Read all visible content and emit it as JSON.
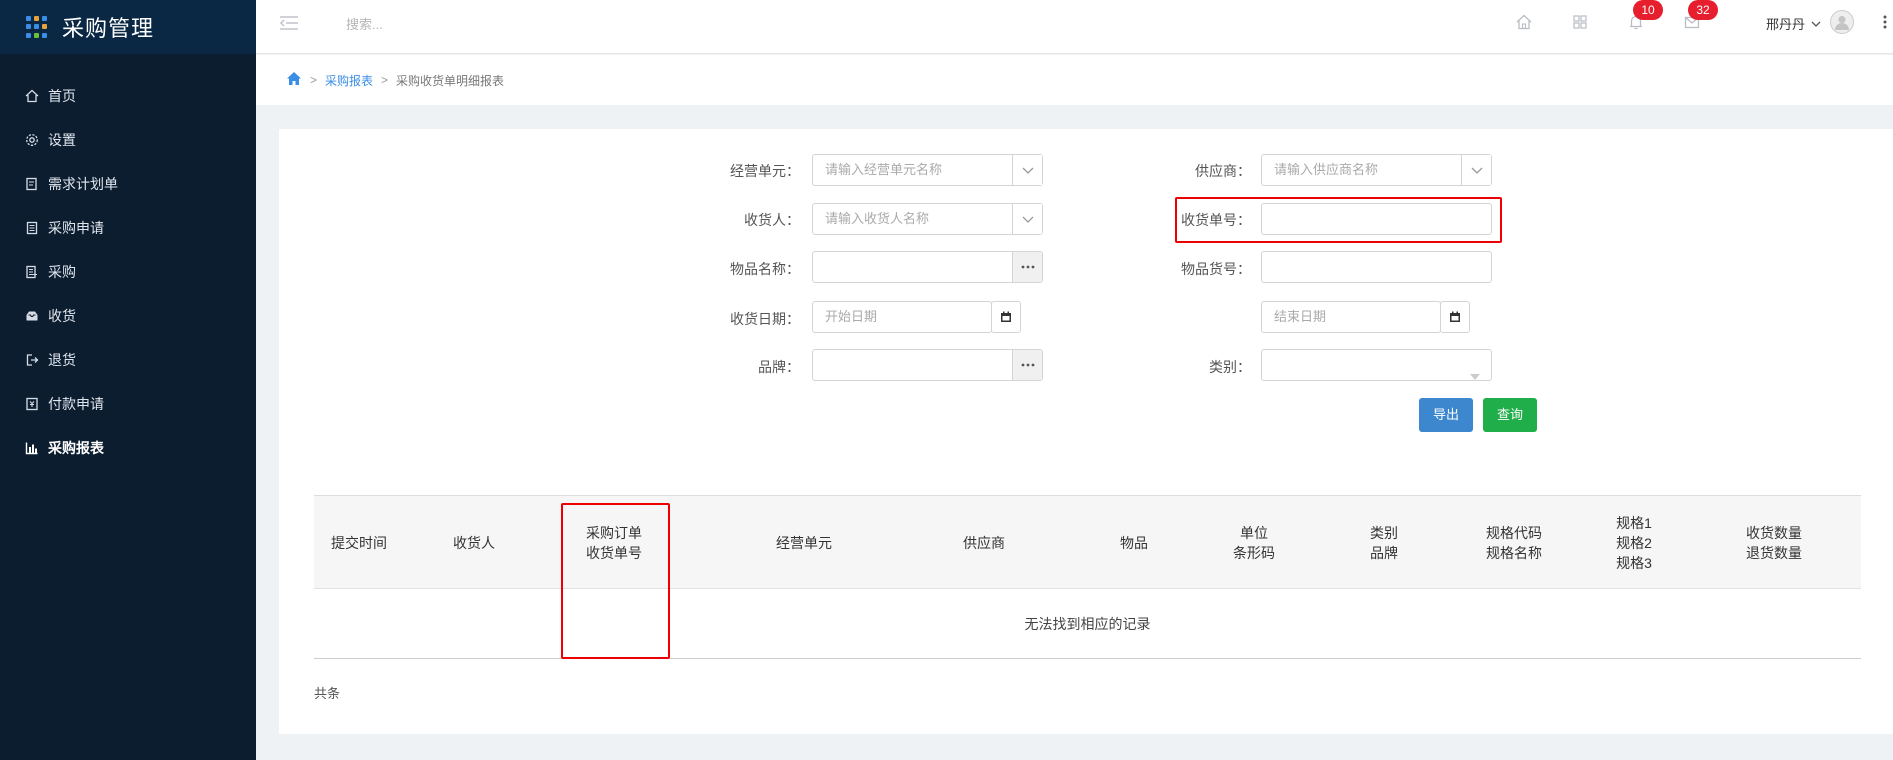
{
  "app": {
    "title": "采购管理"
  },
  "sidebar": {
    "items": [
      {
        "label": "首页",
        "icon": "home-icon"
      },
      {
        "label": "设置",
        "icon": "gear-icon"
      },
      {
        "label": "需求计划单",
        "icon": "document-icon"
      },
      {
        "label": "采购申请",
        "icon": "receipt-icon"
      },
      {
        "label": "采购",
        "icon": "list-icon"
      },
      {
        "label": "收货",
        "icon": "inbox-icon"
      },
      {
        "label": "退货",
        "icon": "logout-icon"
      },
      {
        "label": "付款申请",
        "icon": "payment-icon"
      },
      {
        "label": "采购报表",
        "icon": "bar-chart-icon",
        "active": true
      }
    ]
  },
  "topbar": {
    "search_placeholder": "搜索...",
    "notifications_count": "10",
    "messages_count": "32",
    "user_name": "邢丹丹"
  },
  "breadcrumb": {
    "items": [
      "采购报表",
      "采购收货单明细报表"
    ]
  },
  "form": {
    "unit_label": "经营单元：",
    "unit_placeholder": "请输入经营单元名称",
    "supplier_label": "供应商：",
    "supplier_placeholder": "请输入供应商名称",
    "receiver_label": "收货人：",
    "receiver_placeholder": "请输入收货人名称",
    "receipt_no_label": "收货单号：",
    "receipt_no_value": "",
    "item_name_label": "物品名称：",
    "item_name_value": "",
    "item_code_label": "物品货号：",
    "item_code_value": "",
    "date_label": "收货日期：",
    "start_date_placeholder": "开始日期",
    "end_date_placeholder": "结束日期",
    "brand_label": "品牌：",
    "brand_value": "",
    "category_label": "类别：",
    "category_value": "",
    "export_label": "导出",
    "query_label": "查询"
  },
  "table": {
    "columns": [
      [
        "提交时间"
      ],
      [
        "收货人"
      ],
      [
        "采购订单",
        "收货单号"
      ],
      [
        "经营单元"
      ],
      [
        "供应商"
      ],
      [
        "物品"
      ],
      [
        "单位",
        "条形码"
      ],
      [
        "类别",
        "品牌"
      ],
      [
        "规格代码",
        "规格名称"
      ],
      [
        "规格1",
        "规格2",
        "规格3"
      ],
      [
        "收货数量",
        "退货数量"
      ]
    ],
    "empty_text": "无法找到相应的记录",
    "total_text": "共条"
  },
  "colors": {
    "sidebar_bg": "#0c1d30",
    "accent": "#3a8ee6",
    "export_button": "#3d87cf",
    "query_button": "#1fae4a",
    "badge": "#e61e2d",
    "highlight_box": "#e00000"
  }
}
